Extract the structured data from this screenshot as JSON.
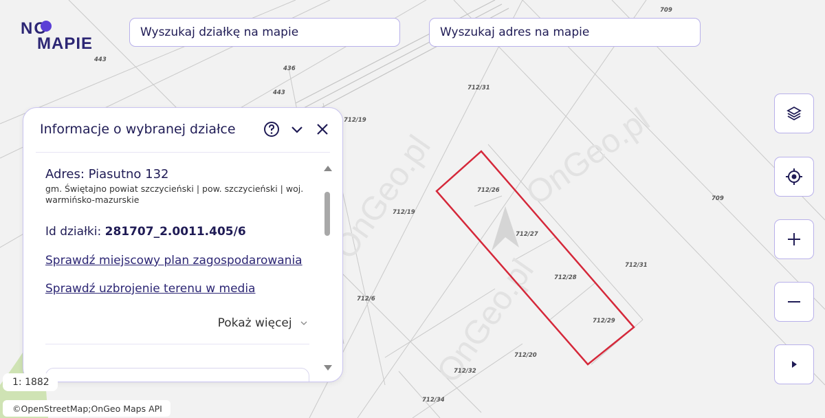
{
  "logo": {
    "line1": "NO",
    "line2": "MAPIE"
  },
  "search": {
    "parcel_placeholder": "Wyszukaj działkę na mapie",
    "address_placeholder": "Wyszukaj adres na mapie"
  },
  "panel": {
    "title": "Informacje o wybranej działce",
    "address": "Adres: Piasutno 132",
    "admin": "gm. Świętajno powiat szczycieński | pow. szczycieński | woj. warmińsko-mazurskie",
    "id_label": "Id działki:",
    "id_value": "281707_2.0011.405/6",
    "link_plan": "Sprawdź miejscowy plan zagospodarowania",
    "link_media": "Sprawdź uzbrojenie terenu w media",
    "show_more": "Pokaż więcej"
  },
  "map": {
    "watermark": "OnGeo.pl",
    "parcel_labels": [
      "709",
      "443",
      "436",
      "443",
      "712/31",
      "712/19",
      "712/19",
      "712/26",
      "712/27",
      "712/28",
      "712/29",
      "712/31",
      "709",
      "712/6",
      "712/20",
      "712/32",
      "712/34"
    ],
    "highlight_color": "#d5283a"
  },
  "controls": [
    "layers-icon",
    "locate-icon",
    "zoom-in-icon",
    "zoom-out-icon",
    "expand-icon"
  ],
  "scale": "1: 1882",
  "attribution": "©OpenStreetMap;OnGeo Maps API"
}
